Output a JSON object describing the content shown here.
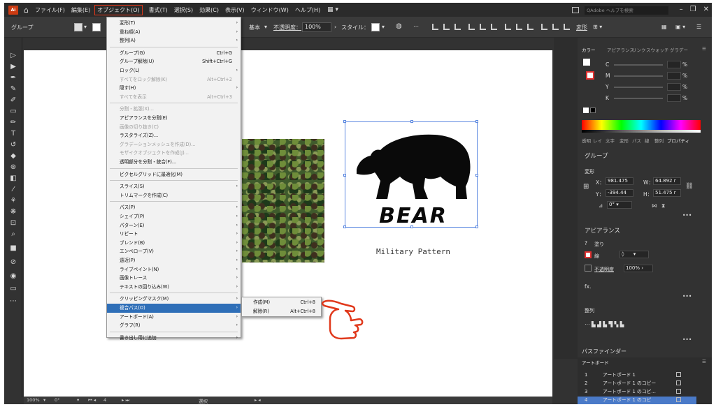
{
  "menubar": {
    "logo": "Ai",
    "items": [
      "ファイル(F)",
      "編集(E)",
      "オブジェクト(O)",
      "書式(T)",
      "選択(S)",
      "効果(C)",
      "表示(V)",
      "ウィンドウ(W)",
      "ヘルプ(H)"
    ],
    "active_index": 2,
    "search_placeholder": "Adobe ヘルプを検索"
  },
  "control_bar": {
    "selection_label": "グループ",
    "stroke_style": "基本",
    "opacity_label": "不透明度：",
    "opacity_value": "100%",
    "style_label": "スタイル：",
    "transform_label": "変形"
  },
  "object_menu": [
    {
      "label": "変形(T)",
      "arrow": true
    },
    {
      "label": "重ね順(A)",
      "arrow": true
    },
    {
      "label": "整列(A)",
      "arrow": true
    },
    {
      "sep": true
    },
    {
      "label": "グループ(G)",
      "shortcut": "Ctrl+G"
    },
    {
      "label": "グループ解除(U)",
      "shortcut": "Shift+Ctrl+G"
    },
    {
      "label": "ロック(L)",
      "arrow": true
    },
    {
      "label": "すべてをロック解除(K)",
      "shortcut": "Alt+Ctrl+2",
      "disabled": true
    },
    {
      "label": "隠す(H)",
      "arrow": true
    },
    {
      "label": "すべてを表示",
      "shortcut": "Alt+Ctrl+3",
      "disabled": true
    },
    {
      "sep": true
    },
    {
      "label": "分割・拡張(X)...",
      "disabled": true
    },
    {
      "label": "アピアランスを分割(E)"
    },
    {
      "label": "画像の切り抜き(C)",
      "disabled": true
    },
    {
      "label": "ラスタライズ(Z)..."
    },
    {
      "label": "グラデーションメッシュを作成(D)...",
      "disabled": true
    },
    {
      "label": "モザイクオブジェクトを作成(J)...",
      "disabled": true
    },
    {
      "label": "透明部分を分割・統合(F)..."
    },
    {
      "sep": true
    },
    {
      "label": "ピクセルグリッドに最適化(M)"
    },
    {
      "sep": true
    },
    {
      "label": "スライス(S)",
      "arrow": true
    },
    {
      "label": "トリムマークを作成(C)"
    },
    {
      "sep": true
    },
    {
      "label": "パス(P)",
      "arrow": true
    },
    {
      "label": "シェイプ(P)",
      "arrow": true
    },
    {
      "label": "パターン(E)",
      "arrow": true
    },
    {
      "label": "リピート",
      "arrow": true
    },
    {
      "label": "ブレンド(B)",
      "arrow": true
    },
    {
      "label": "エンベロープ(V)",
      "arrow": true
    },
    {
      "label": "遠近(P)",
      "arrow": true
    },
    {
      "label": "ライブペイント(N)",
      "arrow": true
    },
    {
      "label": "画像トレース",
      "arrow": true
    },
    {
      "label": "テキストの回り込み(W)",
      "arrow": true
    },
    {
      "sep": true
    },
    {
      "label": "クリッピングマスク(M)",
      "arrow": true
    },
    {
      "label": "複合パス(O)",
      "arrow": true,
      "highlight": true
    },
    {
      "label": "アートボード(A)",
      "arrow": true
    },
    {
      "label": "グラフ(R)",
      "arrow": true
    },
    {
      "sep": true
    },
    {
      "label": "書き出し用に追加",
      "arrow": true
    }
  ],
  "compound_path_submenu": [
    {
      "label": "作成(M)",
      "shortcut": "Ctrl+8"
    },
    {
      "label": "解除(R)",
      "shortcut": "Alt+Ctrl+8"
    }
  ],
  "canvas": {
    "logo_text": "BEAR",
    "caption": "Military Pattern"
  },
  "color_panel": {
    "tabs": [
      "カラー",
      "アピアランス",
      "リンク",
      "スウォッチ",
      "グラデー"
    ],
    "channels": [
      "C",
      "M",
      "Y",
      "K"
    ],
    "unit": "%"
  },
  "properties_panel": {
    "tabs": [
      "透明",
      "レイ",
      "文字",
      "変形",
      "パス",
      "線",
      "整列",
      "プロパティ"
    ],
    "group_label": "グループ",
    "transform_heading": "変形",
    "x_label": "X：",
    "x_value": "981.475",
    "y_label": "Y：",
    "y_value": "-394.44",
    "w_label": "W：",
    "w_value": "64.892 r",
    "h_label": "H：",
    "h_value": "51.475 r",
    "angle_value": "0°",
    "appearance_heading": "アピアランス",
    "fill_label": "塗り",
    "stroke_label": "線",
    "opacity_label": "不透明度",
    "opacity_value": "100%",
    "fx_label": "fx.",
    "align_heading": "整列",
    "pathfinder_heading": "パスファインダー"
  },
  "artboards_panel": {
    "title": "アートボード",
    "rows": [
      {
        "num": "1",
        "name": "アートボード 1"
      },
      {
        "num": "2",
        "name": "アートボード 1 のコピー"
      },
      {
        "num": "3",
        "name": "アートボード 1 のコピ..."
      },
      {
        "num": "4",
        "name": "アートボード 1 のコピ"
      }
    ]
  },
  "status_bar": {
    "zoom": "100%",
    "angle": "0°",
    "artboard_num": "4",
    "tool": "選択"
  },
  "colors": {
    "menu_highlight": "#2f6fb8",
    "annotation_red": "#e0381b",
    "ui_dark": "#323232"
  }
}
